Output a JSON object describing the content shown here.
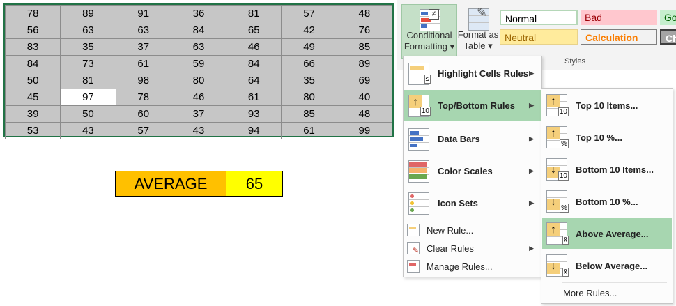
{
  "grid": {
    "rows": [
      [
        "78",
        "89",
        "91",
        "36",
        "81",
        "57",
        "48"
      ],
      [
        "56",
        "63",
        "63",
        "84",
        "65",
        "42",
        "76"
      ],
      [
        "83",
        "35",
        "37",
        "63",
        "46",
        "49",
        "85"
      ],
      [
        "84",
        "73",
        "61",
        "59",
        "84",
        "66",
        "89"
      ],
      [
        "50",
        "81",
        "98",
        "80",
        "64",
        "35",
        "69"
      ],
      [
        "45",
        "97",
        "78",
        "46",
        "61",
        "80",
        "40"
      ],
      [
        "39",
        "50",
        "60",
        "37",
        "93",
        "85",
        "48"
      ],
      [
        "53",
        "43",
        "57",
        "43",
        "94",
        "61",
        "99"
      ]
    ]
  },
  "average": {
    "label": "AVERAGE",
    "value": "65"
  },
  "ribbon": {
    "conditional_formatting": [
      "Conditional",
      "Formatting ▾"
    ],
    "format_as_table": [
      "Format as",
      "Table ▾"
    ],
    "styles": {
      "normal": "Normal",
      "bad": "Bad",
      "good": "Go",
      "neutral": "Neutral",
      "calculation": "Calculation",
      "check": "Ch",
      "group_label": "Styles"
    }
  },
  "menu": {
    "items": [
      {
        "label": "Highlight Cells Rules"
      },
      {
        "label": "Top/Bottom Rules"
      },
      {
        "label": "Data Bars"
      },
      {
        "label": "Color Scales"
      },
      {
        "label": "Icon Sets"
      },
      {
        "label": "New Rule..."
      },
      {
        "label": "Clear Rules"
      },
      {
        "label": "Manage Rules..."
      }
    ]
  },
  "submenu": {
    "items": [
      {
        "label": "Top 10 Items...",
        "tag": "10"
      },
      {
        "label": "Top 10 %...",
        "tag": "%"
      },
      {
        "label": "Bottom 10 Items...",
        "tag": "10"
      },
      {
        "label": "Bottom 10 %...",
        "tag": "%"
      },
      {
        "label": "Above Average...",
        "tag": "x̄"
      },
      {
        "label": "Below Average...",
        "tag": "x̄"
      },
      {
        "label": "More Rules..."
      }
    ]
  },
  "colors": {
    "accent_green": "#217346",
    "highlight": "#a7d6b0",
    "average_label_bg": "#ffc000",
    "average_value_bg": "#ffff00"
  }
}
